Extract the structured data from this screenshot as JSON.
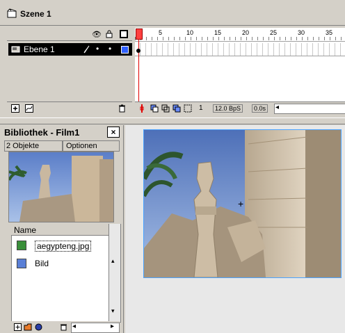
{
  "scene": {
    "title": "Szene 1",
    "icon": "scene-icon"
  },
  "timeline": {
    "layer": {
      "name": "Ebene 1"
    },
    "ruler_numbers": [
      "1",
      "5",
      "10",
      "15",
      "20",
      "25",
      "30",
      "35"
    ],
    "status": {
      "current_frame": "1",
      "fps": "12.0 BpS",
      "time": "0.0s"
    }
  },
  "library": {
    "title": "Bibliothek - Film1",
    "close": "×",
    "count": "2 Objekte",
    "options": "Optionen",
    "column_name": "Name",
    "items": [
      {
        "label": "aegypteng.jpg",
        "icon": "bitmap-icon"
      },
      {
        "label": "Bild",
        "icon": "graphic-symbol-icon"
      }
    ]
  },
  "colors": {
    "background": "#d4d0c8",
    "selection": "#000000",
    "playhead": "#e00000",
    "stage_border": "#4aa3ff"
  }
}
